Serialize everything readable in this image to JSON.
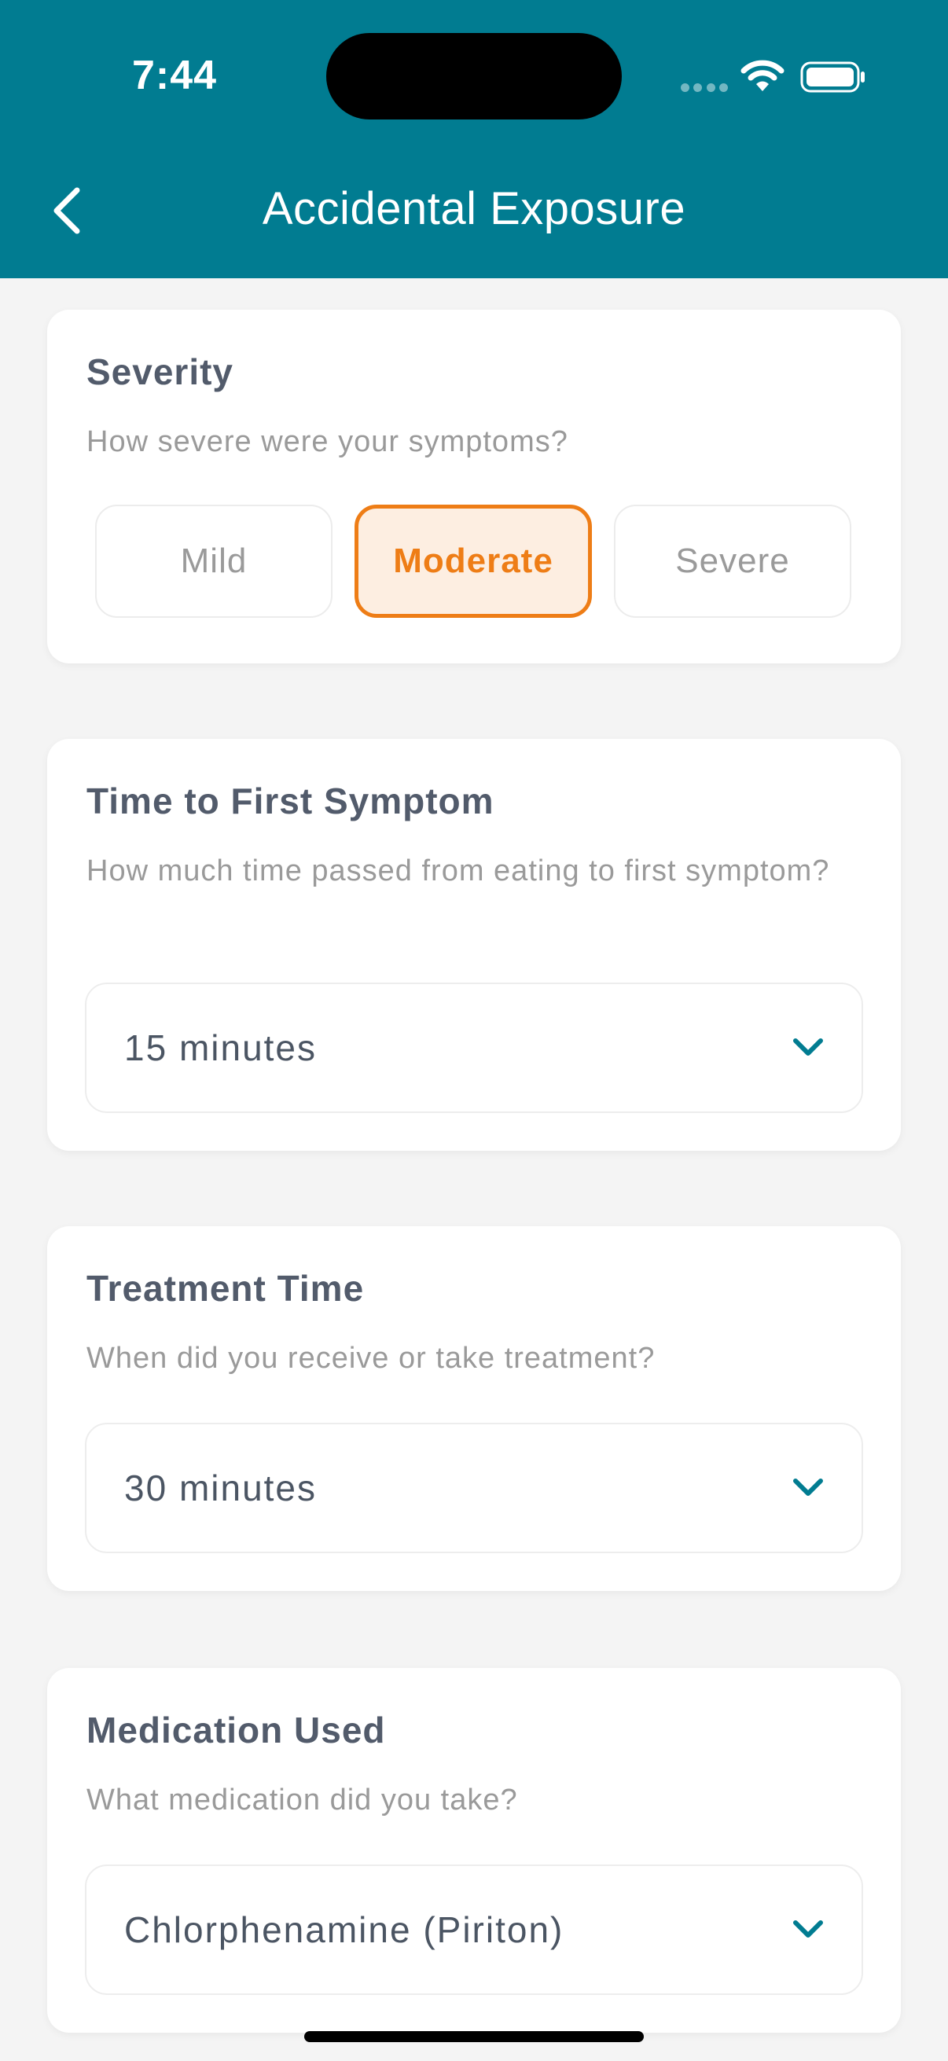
{
  "status_bar": {
    "time": "7:44"
  },
  "header": {
    "title": "Accidental Exposure"
  },
  "colors": {
    "header": "#017c91",
    "accent": "#ee7d16",
    "accent_bg": "#fdeee1",
    "chevron": "#017c91"
  },
  "severity": {
    "title": "Severity",
    "subtitle": "How severe were your symptoms?",
    "options": [
      "Mild",
      "Moderate",
      "Severe"
    ],
    "selected": "Moderate"
  },
  "time_to_first_symptom": {
    "title": "Time to First Symptom",
    "subtitle": "How much time passed from eating to first symptom?",
    "value": "15 minutes"
  },
  "treatment_time": {
    "title": "Treatment Time",
    "subtitle": "When did you receive or take treatment?",
    "value": "30 minutes"
  },
  "medication_used": {
    "title": "Medication Used",
    "subtitle": "What medication did you take?",
    "value": "Chlorphenamine (Piriton)"
  }
}
